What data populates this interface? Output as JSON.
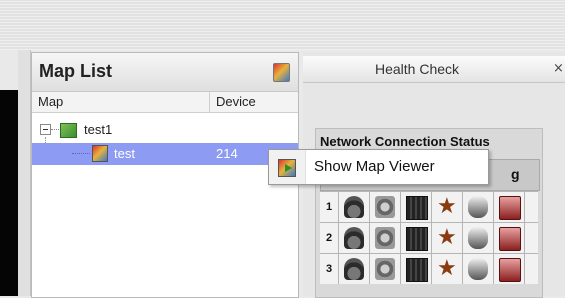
{
  "map_list": {
    "title": "Map List",
    "columns": [
      "Map",
      "Device"
    ],
    "rows": [
      {
        "label": "test1",
        "device": "",
        "level": 0,
        "expander": "minus",
        "icon": "map-group-icon"
      },
      {
        "label": "test",
        "device": "214",
        "level": 1,
        "selected": true,
        "icon": "map-icon"
      }
    ]
  },
  "health_check": {
    "tab_title": "Health Check",
    "close_glyph": "×",
    "section_title": "Network Connection Status",
    "header_fragment": "g",
    "row_numbers": [
      "1",
      "2",
      "3"
    ],
    "status_icons": [
      "camera-icon",
      "dome-camera-icon",
      "recording-icon",
      "motion-sensor-icon",
      "storage-icon",
      "alarm-speaker-icon"
    ]
  },
  "context_menu": {
    "items": [
      {
        "label": "Show Map Viewer",
        "icon": "map-viewer-icon"
      }
    ]
  },
  "colors": {
    "selection": "#8e9bf2",
    "panel_bg": "#e6e6e6"
  }
}
